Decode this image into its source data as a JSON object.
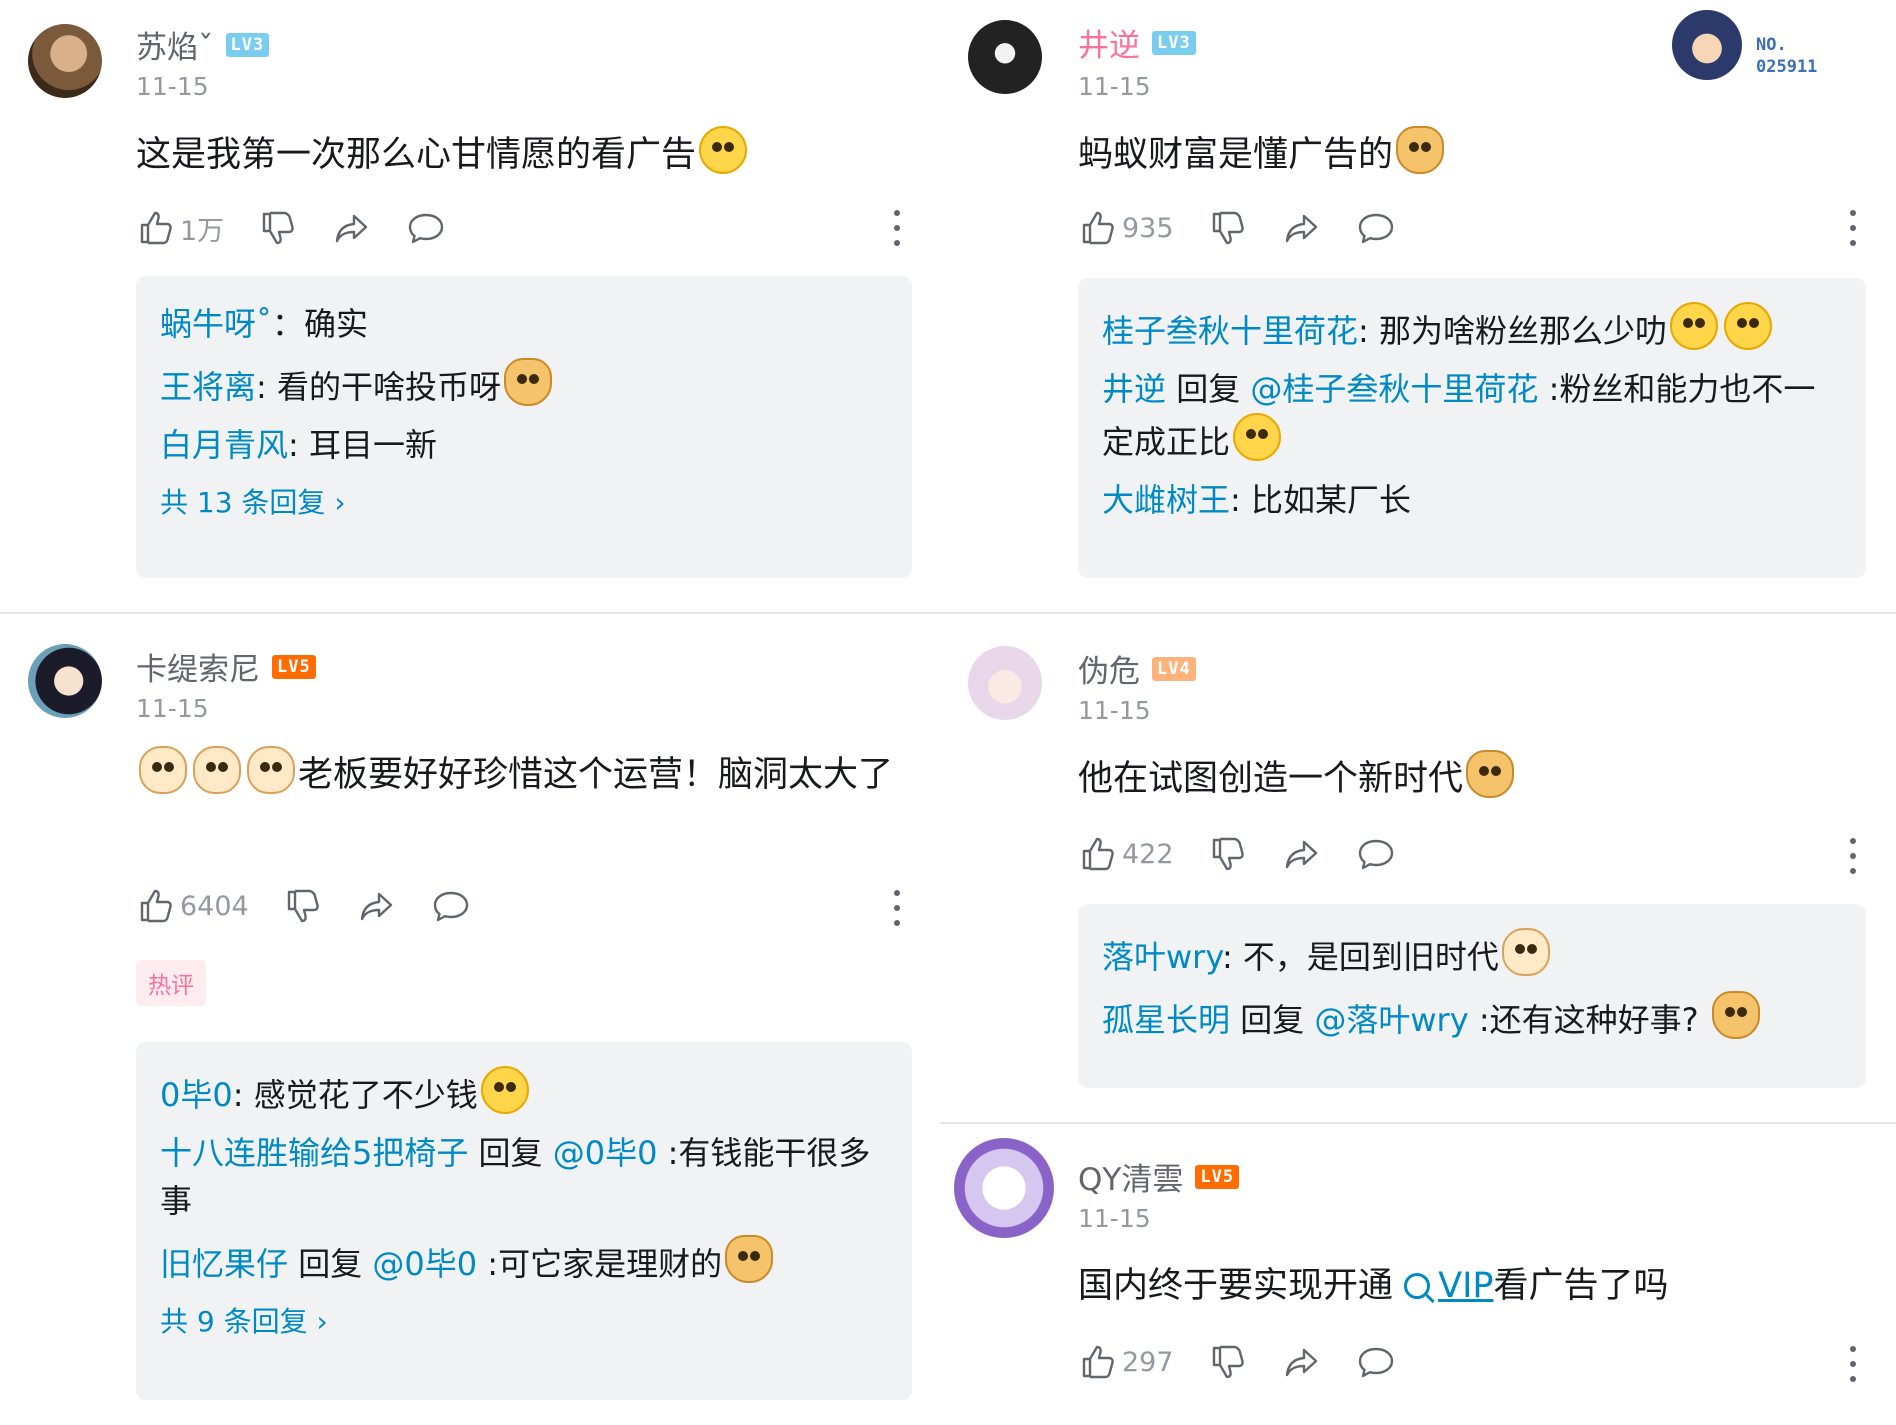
{
  "comments": [
    {
      "user": "苏焰ˇ",
      "level": "LV3",
      "date": "11-15",
      "content": "这是我第一次那么心甘情愿的看广告",
      "likes": "1万",
      "replies": [
        {
          "user": "蜗牛呀˚",
          "text": "：确实"
        },
        {
          "user": "王将离",
          "text": ": 看的干啥投币呀"
        },
        {
          "user": "白月青风",
          "text": ": 耳目一新"
        }
      ],
      "reply_more": "共 13 条回复"
    },
    {
      "user": "井逆",
      "level": "LV3",
      "date": "11-15",
      "content": "蚂蚁财富是懂广告的",
      "likes": "935",
      "badge_label": "NO.",
      "badge_number": "025911",
      "replies": [
        {
          "user": "桂子叁秋十里荷花",
          "text": ": 那为啥粉丝那么少叻"
        },
        {
          "user": "井逆",
          "reply_word": " 回复 ",
          "at": "@桂子叁秋十里荷花",
          "text": " :粉丝和能力也不一定成正比"
        },
        {
          "user": "大雌树王",
          "text": ": 比如某厂长"
        }
      ]
    },
    {
      "user": "卡缇索尼",
      "level": "LV5",
      "date": "11-15",
      "content": "老板要好好珍惜这个运营！脑洞太大了",
      "likes": "6404",
      "hot_tag": "热评",
      "replies": [
        {
          "user": "0毕0",
          "text": ": 感觉花了不少钱"
        },
        {
          "user": "十八连胜输给5把椅子",
          "reply_word": " 回复 ",
          "at": "@0毕0",
          "text": " :有钱能干很多事"
        },
        {
          "user": "旧忆果仔",
          "reply_word": " 回复 ",
          "at": "@0毕0",
          "text": " :可它家是理财的"
        }
      ],
      "reply_more": "共 9 条回复"
    },
    {
      "user": "伪危",
      "level": "LV4",
      "date": "11-15",
      "content": "他在试图创造一个新时代",
      "likes": "422",
      "replies": [
        {
          "user": "落叶wry",
          "text": ": 不，是回到旧时代"
        },
        {
          "user": "孤星长明",
          "reply_word": " 回复 ",
          "at": "@落叶wry",
          "text": " :还有这种好事?"
        }
      ]
    },
    {
      "user": "QY清雲",
      "level": "LV5",
      "date": "11-15",
      "content_prefix": "国内终于要实现开通 ",
      "content_link": "VIP",
      "content_suffix": "看广告了吗",
      "likes": "297"
    }
  ],
  "colors": {
    "link": "#008ac5",
    "pink": "#fb7299",
    "reply_bg": "#f1f2f3",
    "muted": "#9499a0"
  },
  "icons": [
    "thumb-up-icon",
    "thumb-down-icon",
    "share-icon",
    "comment-icon",
    "more-icon"
  ]
}
